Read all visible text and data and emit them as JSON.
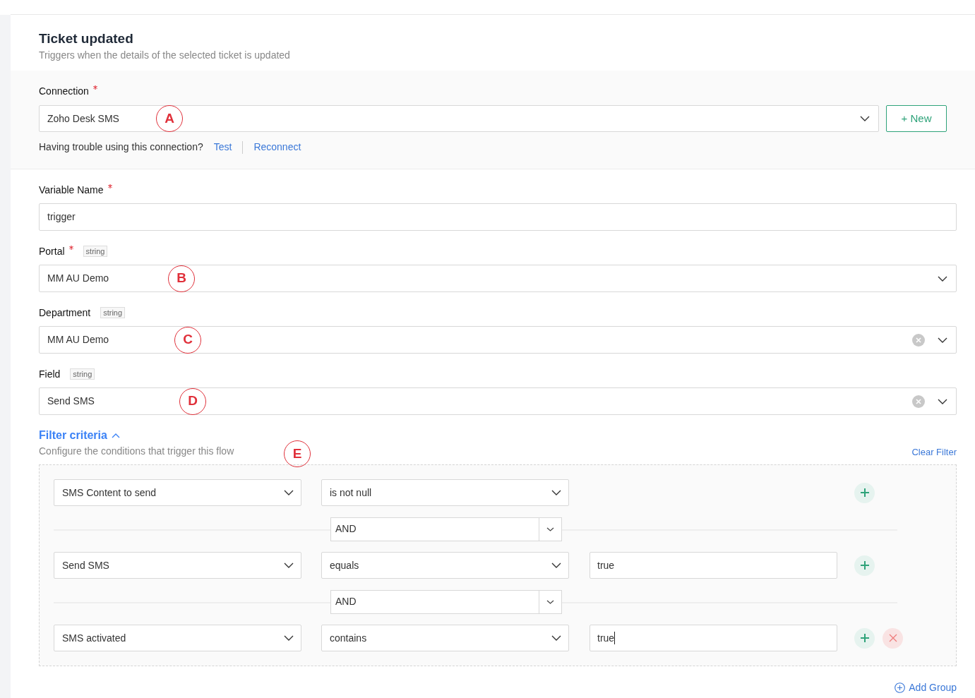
{
  "header": {
    "title": "Ticket updated",
    "subtitle": "Triggers when the details of the selected ticket is updated"
  },
  "connection": {
    "label": "Connection",
    "required": true,
    "value": "Zoho Desk SMS",
    "marker": "A",
    "new_button": "+ New",
    "help_text": "Having trouble using this connection?",
    "links": [
      "Test",
      "Reconnect"
    ]
  },
  "fields": [
    {
      "kind": "text",
      "label": "Variable Name",
      "required": true,
      "value": "trigger"
    },
    {
      "kind": "select",
      "label": "Portal",
      "required": true,
      "type_tag": "string",
      "value": "MM AU Demo",
      "clearable": false,
      "marker": "B"
    },
    {
      "kind": "select",
      "label": "Department",
      "required": false,
      "type_tag": "string",
      "value": "MM AU Demo",
      "clearable": true,
      "marker": "C"
    },
    {
      "kind": "select",
      "label": "Field",
      "required": false,
      "type_tag": "string",
      "value": "Send SMS",
      "clearable": true,
      "marker": "D"
    }
  ],
  "filter": {
    "title": "Filter criteria",
    "expanded": true,
    "description": "Configure the conditions that trigger this flow",
    "marker": "E",
    "clear_link": "Clear Filter",
    "rows": [
      {
        "field": "SMS Content to send",
        "operator": "is not null",
        "removable": false
      },
      {
        "connector": "AND",
        "field": "Send SMS",
        "operator": "equals",
        "value": "true",
        "focused": false,
        "removable": false
      },
      {
        "connector": "AND",
        "field": "SMS activated",
        "operator": "contains",
        "value": "true",
        "focused": true,
        "removable": true
      }
    ],
    "add_group": "Add Group"
  }
}
